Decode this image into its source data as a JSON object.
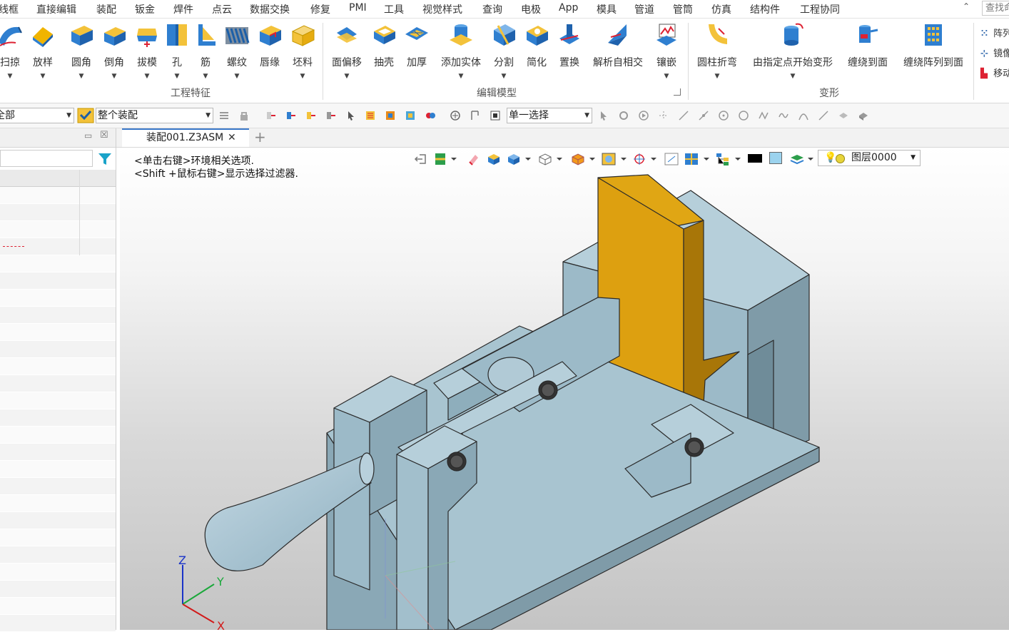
{
  "menu": [
    "线框",
    "直接编辑",
    "装配",
    "钣金",
    "焊件",
    "点云",
    "数据交换",
    "修复",
    "PMI",
    "工具",
    "视觉样式",
    "查询",
    "电极",
    "App",
    "模具",
    "管道",
    "管筒",
    "仿真",
    "结构件",
    "工程协同"
  ],
  "search": {
    "placeholder": "查找命令"
  },
  "ribbon": {
    "group1": {
      "label": "工程特征",
      "buttons": [
        "扫掠",
        "放样",
        "圆角",
        "倒角",
        "拔模",
        "孔",
        "筋",
        "螺纹",
        "唇缘",
        "坯料"
      ]
    },
    "group2": {
      "label": "编辑模型",
      "buttons": [
        "面偏移",
        "抽壳",
        "加厚",
        "添加实体",
        "分割",
        "简化",
        "置换",
        "解析自相交",
        "镶嵌"
      ]
    },
    "group3": {
      "label": "变形",
      "buttons": [
        "圆柱折弯",
        "由指定点开始变形",
        "缠绕到面",
        "缠绕阵列到面"
      ]
    },
    "mini_buttons": [
      "阵列",
      "镜像",
      "移动"
    ]
  },
  "toolbar": {
    "filter_combo": "全部",
    "scope_combo": "整个装配",
    "select_combo": "单一选择"
  },
  "tabs": {
    "active": "装配001.Z3ASM",
    "close": "✕",
    "add": "+"
  },
  "viewport": {
    "hints": [
      "<单击右键>环境相关选项.",
      "<Shift +鼠标右键>显示选择过滤器."
    ],
    "layer": "图层0000",
    "axes": {
      "x": "X",
      "y": "Y",
      "z": "Z"
    }
  },
  "colors": {
    "part_blue": "#9bbac8",
    "part_orange": "#dda010",
    "accent": "#3a78c9"
  }
}
